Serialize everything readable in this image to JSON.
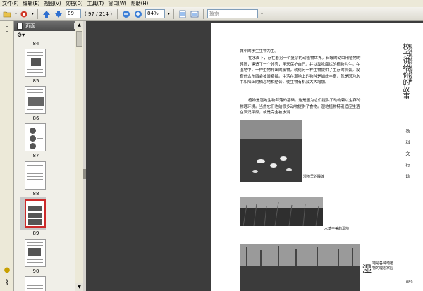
{
  "menu": [
    "文件(F)",
    "编辑(E)",
    "视图(V)",
    "文档(D)",
    "工具(T)",
    "窗口(W)",
    "帮助(H)"
  ],
  "toolbar": {
    "page_value": "89",
    "page_total": "( 97 / 214 )",
    "zoom_value": "84%",
    "search_placeholder": "搜索"
  },
  "panel": {
    "title": "页面",
    "thumbnails": [
      {
        "label": "84"
      },
      {
        "label": "85"
      },
      {
        "label": "86"
      },
      {
        "label": "87"
      },
      {
        "label": "88"
      },
      {
        "label": "89",
        "selected": true
      },
      {
        "label": "90"
      }
    ]
  },
  "page": {
    "para1": "微小的水生生物为生。",
    "para2": "在水面下，存在着另一个复杂的动植物世界。石蛾的幼虫用植物的碎屑，建造了一个外壳，用来保护自己，并以靠吃腐烂的植物为生。在湿地中，一种生物排出的废物，就给另一种生物提供了生存的机会。没有什么东西会被浪费掉。生活在湿地上的物种是如此丰富，就是因为水中和陆上的栖息地相结合，使生物有机会大大增加。",
    "para3": "植物是湿地生物群落的基础。这是因为它们提供了动物赖以生存的物理环境。当然它们也给很多动物提供了食物。湿地植物特别适应生活在洪泛平原，或是完全被水浸",
    "caption1": "湿地里的睡莲",
    "caption2": "水草丰美的湿地",
    "caption3_big": "湿",
    "caption3": "地是各种动植物的理想家园",
    "vertical_title": "校长讲给你的故事",
    "vertical_subtitle": "极其挑战的地球故事",
    "vertical_section": "教科文行动",
    "page_number": "089"
  }
}
